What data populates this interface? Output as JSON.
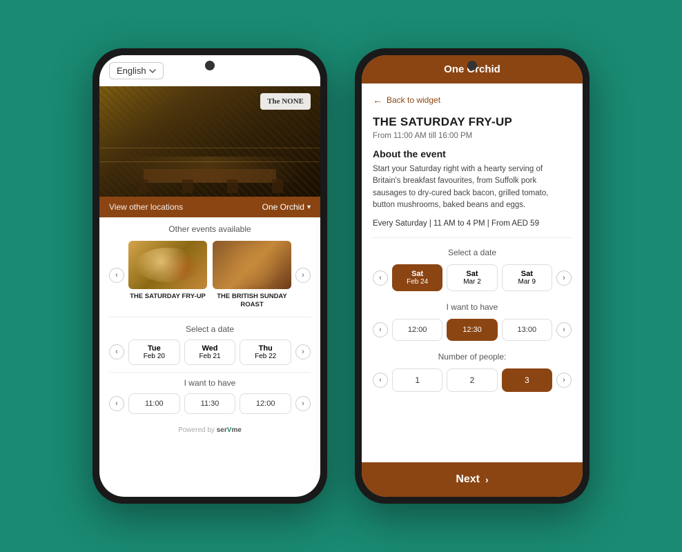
{
  "background": "#1a8a72",
  "left_phone": {
    "language": {
      "label": "English",
      "dropdown_icon": "▾"
    },
    "restaurant_logo": "The NONE",
    "location_bar": {
      "left_label": "View other locations",
      "right_label": "One Orchid",
      "icon": "▾"
    },
    "events": {
      "title": "Other events available",
      "items": [
        {
          "name": "THE SATURDAY FRY-UP",
          "image_type": "fryup"
        },
        {
          "name": "THE BRITISH SUNDAY ROAST",
          "image_type": "roast"
        }
      ]
    },
    "date_selector": {
      "title": "Select a date",
      "dates": [
        {
          "day": "Tue",
          "num": "Feb 20",
          "active": false
        },
        {
          "day": "Wed",
          "num": "Feb 21",
          "active": false
        },
        {
          "day": "Thu",
          "num": "Feb 22",
          "active": false
        }
      ]
    },
    "time_selector": {
      "title": "I want to have",
      "times": [
        {
          "label": "11:00",
          "active": false
        },
        {
          "label": "11:30",
          "active": false
        },
        {
          "label": "12:00",
          "active": false
        }
      ]
    },
    "powered_by": "Powered by",
    "brand": "serVme"
  },
  "right_phone": {
    "header": "One Orchid",
    "back_link": "Back to widget",
    "event_name": "THE SATURDAY FRY-UP",
    "event_time": "From 11:00 AM till 16:00 PM",
    "about_title": "About the event",
    "about_text": "Start your Saturday right with a hearty serving of Britain's breakfast favourites, from Suffolk pork sausages to dry-cured back bacon, grilled tomato, button mushrooms, baked beans and eggs.",
    "event_summary": "Every Saturday | 11 AM to 4 PM | From AED 59",
    "date_selector": {
      "title": "Select a date",
      "dates": [
        {
          "day": "Sat",
          "num": "Feb 24",
          "active": true
        },
        {
          "day": "Sat",
          "num": "Mar 2",
          "active": false
        },
        {
          "day": "Sat",
          "num": "Mar 9",
          "active": false
        }
      ]
    },
    "time_selector": {
      "title": "I want to have",
      "times": [
        {
          "label": "12:00",
          "active": false
        },
        {
          "label": "12:30",
          "active": true
        },
        {
          "label": "13:00",
          "active": false
        }
      ]
    },
    "people_selector": {
      "title": "Number of people:",
      "values": [
        {
          "label": "1",
          "active": false
        },
        {
          "label": "2",
          "active": false
        },
        {
          "label": "3",
          "active": true
        }
      ]
    },
    "next_button": "Next",
    "next_icon": "›"
  }
}
